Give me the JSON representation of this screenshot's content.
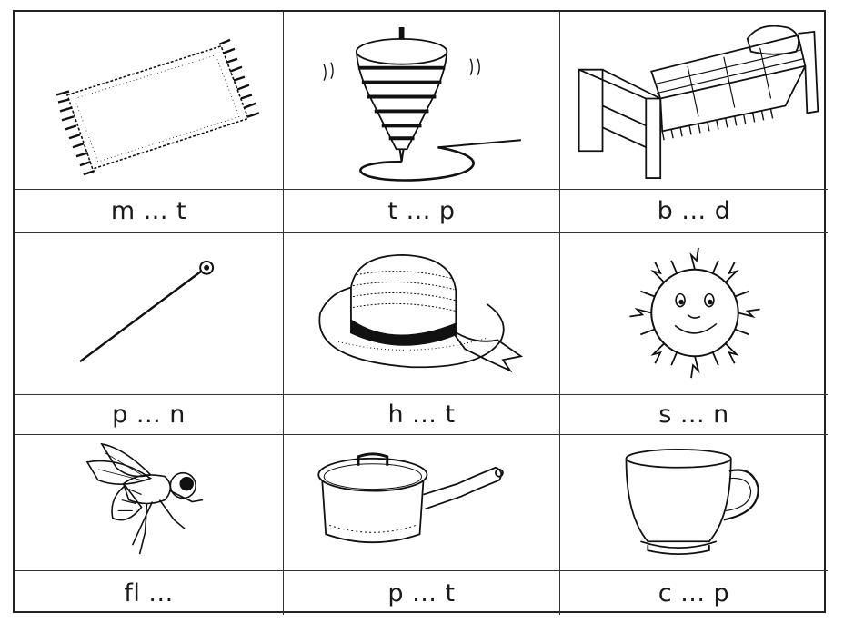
{
  "worksheet": {
    "cards": [
      {
        "word": "m ... t",
        "icon": "rug-icon"
      },
      {
        "word": "t ... p",
        "icon": "spinning-top-icon"
      },
      {
        "word": "b ... d",
        "icon": "bed-icon"
      },
      {
        "word": "p ... n",
        "icon": "pin-icon"
      },
      {
        "word": "h ... t",
        "icon": "hat-icon"
      },
      {
        "word": "s ... n",
        "icon": "sun-icon"
      },
      {
        "word": "fl ...",
        "icon": "fly-icon"
      },
      {
        "word": "p ... t",
        "icon": "pot-icon"
      },
      {
        "word": "c ... p",
        "icon": "cup-icon"
      }
    ],
    "colors": {
      "ink": "#1a1a1a",
      "paper": "#ffffff"
    }
  }
}
